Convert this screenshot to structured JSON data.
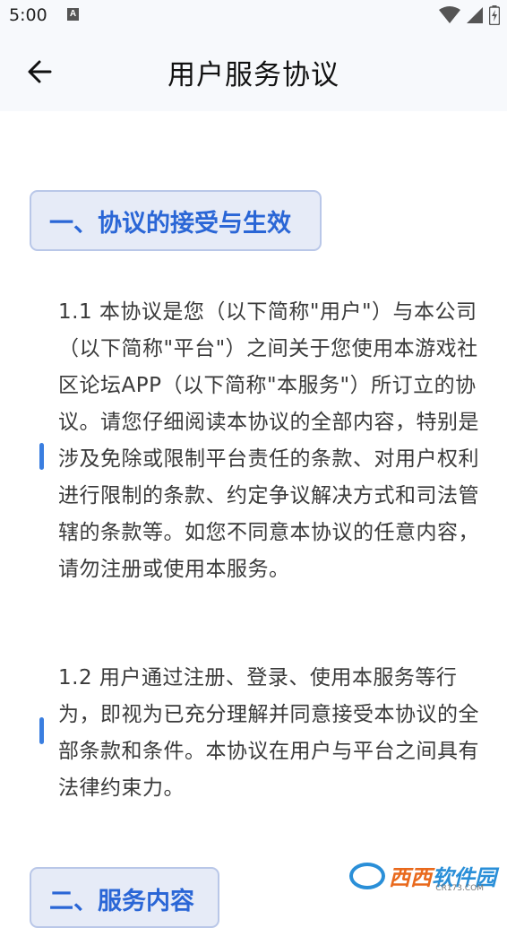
{
  "status_bar": {
    "time": "5:00",
    "notification_icon": "a-icon",
    "icons": [
      "wifi-icon",
      "signal-icon",
      "battery-charging-icon"
    ]
  },
  "app_bar": {
    "title": "用户服务协议",
    "back_icon": "arrow-left-icon"
  },
  "sections": [
    {
      "header": "一、协议的接受与生效",
      "paragraphs": [
        "1.1 本协议是您（以下简称\"用户\"）与本公司（以下简称\"平台\"）之间关于您使用本游戏社区论坛APP（以下简称\"本服务\"）所订立的协议。请您仔细阅读本协议的全部内容，特别是涉及免除或限制平台责任的条款、对用户权利进行限制的条款、约定争议解决方式和司法管辖的条款等。如您不同意本协议的任意内容，请勿注册或使用本服务。",
        "1.2 用户通过注册、登录、使用本服务等行为，即视为已充分理解并同意接受本协议的全部条款和条件。本协议在用户与平台之间具有法律约束力。"
      ]
    },
    {
      "header": "二、服务内容"
    }
  ],
  "watermark": {
    "text_a": "西西",
    "text_b": "软件园",
    "sub": "CR173.COM"
  },
  "colors": {
    "accent": "#2a66d6",
    "header_bg": "#e6ebf7",
    "appbar_bg": "#f7f9fc"
  }
}
